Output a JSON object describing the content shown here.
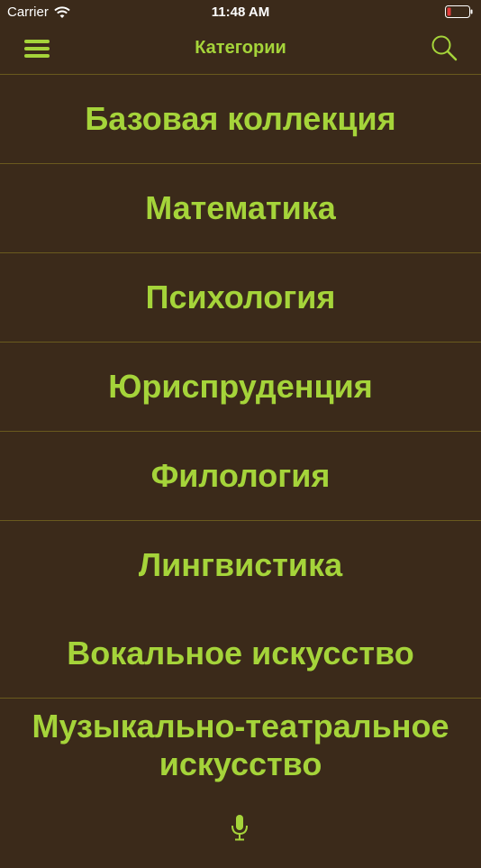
{
  "status_bar": {
    "carrier": "Carrier",
    "time": "11:48 AM"
  },
  "nav": {
    "title": "Категории"
  },
  "categories": [
    {
      "label": "Базовая коллекция"
    },
    {
      "label": "Математика"
    },
    {
      "label": "Психология"
    },
    {
      "label": "Юриспруденция"
    },
    {
      "label": "Филология"
    },
    {
      "label": "Лингвистика"
    },
    {
      "label": "Вокальное искусство"
    },
    {
      "label": "Музыкально-театральное искусство"
    }
  ],
  "colors": {
    "background": "#3b2a1a",
    "accent": "#a5d43a",
    "divider": "#6a5a1e",
    "battery_low": "#e23b3b"
  },
  "icons": {
    "menu": "hamburger-icon",
    "search": "search-icon",
    "mic": "microphone-icon",
    "wifi": "wifi-icon",
    "battery": "battery-icon"
  }
}
